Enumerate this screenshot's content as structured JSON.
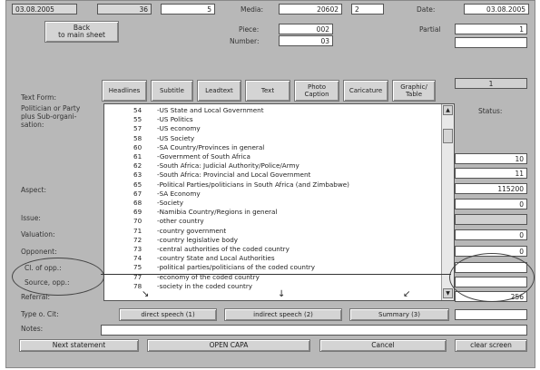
{
  "top": {
    "date1": "03.08.2005",
    "field2": "36",
    "field3": "5",
    "media_label": "Media:",
    "media_value": "20602",
    "field5": "2",
    "date_label": "Date:",
    "date2": "03.08.2005"
  },
  "back_button": "Back\nto main sheet",
  "piece": {
    "piece_label": "Piece:",
    "piece_value": "002",
    "number_label": "Number:",
    "number_value": "03",
    "partial_label": "Partial",
    "partial_value": "1",
    "partial_value2": ""
  },
  "text_form_label": "Text Form:",
  "text_forms": [
    "Headlines",
    "Subtitle",
    "Leadtext",
    "Text",
    "Photo Caption",
    "Caricature",
    "Graphic/ Table"
  ],
  "text_form_right": "1",
  "status_label": "Status:",
  "left_labels": [
    "Politician or Party plus Sub-organi-sation:",
    "Aspect:",
    "Issue:",
    "Valuation:",
    "Opponent:",
    "Cl. of opp.:",
    "Source, opp.:",
    "Referral:",
    "Type o. Cit:",
    "Notes:"
  ],
  "list": [
    {
      "code": "54",
      "desc": "-US State and Local Government"
    },
    {
      "code": "55",
      "desc": "-US Politics"
    },
    {
      "code": "57",
      "desc": "-US economy"
    },
    {
      "code": "58",
      "desc": "-US Society"
    },
    {
      "code": "60",
      "desc": "-SA Country/Provinces in general"
    },
    {
      "code": "61",
      "desc": "-Government of South Africa"
    },
    {
      "code": "62",
      "desc": "-South Africa: Judicial Authority/Police/Army"
    },
    {
      "code": "63",
      "desc": "-South Africa: Provincial and Local Government"
    },
    {
      "code": "65",
      "desc": "-Political Parties/politicians in South Africa (and Zimbabwe)"
    },
    {
      "code": "67",
      "desc": "-SA Economy"
    },
    {
      "code": "68",
      "desc": "-Society"
    },
    {
      "code": "69",
      "desc": "-Namibia Country/Regions in general"
    },
    {
      "code": "70",
      "desc": "-other country"
    },
    {
      "code": "71",
      "desc": "-country government"
    },
    {
      "code": "72",
      "desc": "-country legislative body"
    },
    {
      "code": "73",
      "desc": "-central authorities of the coded country"
    },
    {
      "code": "74",
      "desc": "-country State and Local Authorities"
    },
    {
      "code": "75",
      "desc": "-political parties/politicians of the coded country"
    },
    {
      "code": "77",
      "desc": "-economy of the coded country"
    },
    {
      "code": "78",
      "desc": "-society in the coded country"
    }
  ],
  "right_values": [
    "10",
    "11",
    "115200",
    "0",
    "",
    "0",
    "0",
    "",
    "",
    "256",
    ""
  ],
  "speech_buttons": [
    "direct speech (1)",
    "indirect speech (2)",
    "Summary (3)"
  ],
  "bottom_buttons": [
    "Next statement",
    "OPEN CAPA",
    "Cancel",
    "clear screen"
  ]
}
